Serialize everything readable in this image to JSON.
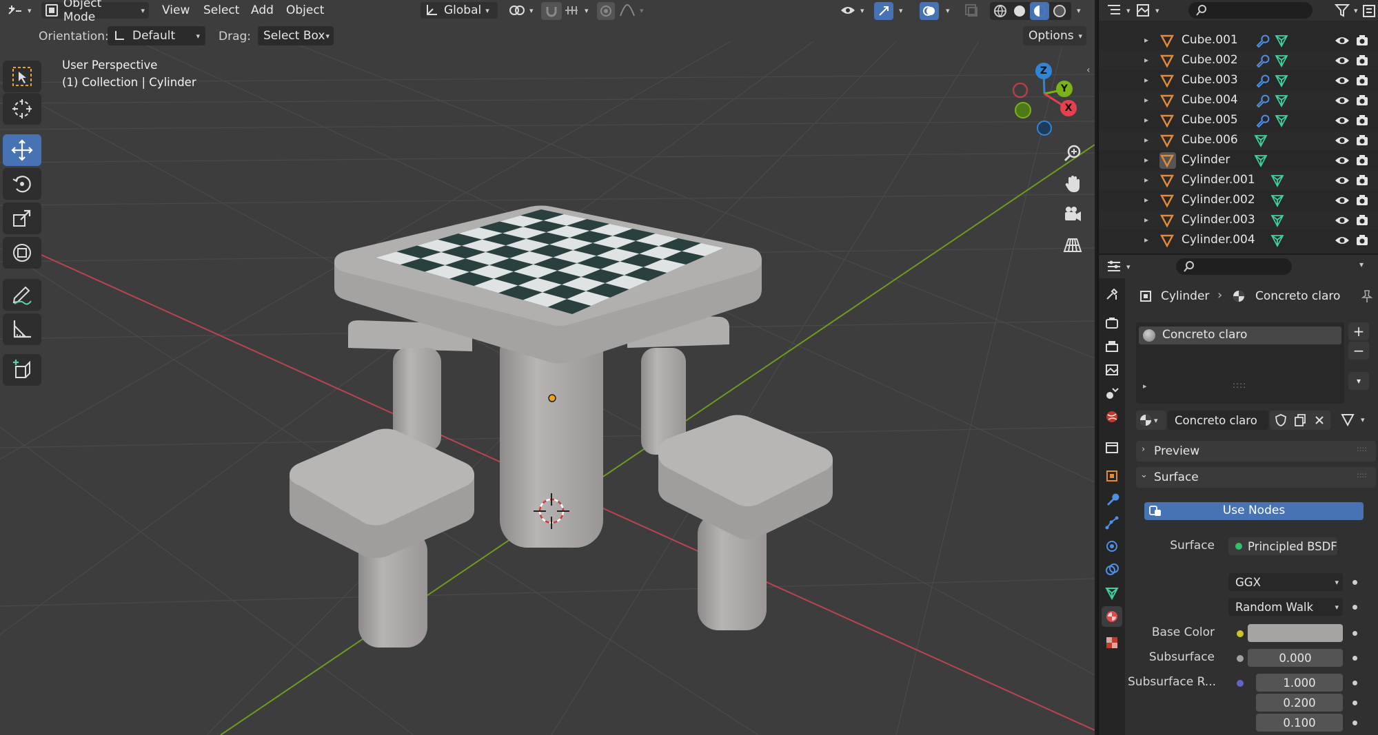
{
  "header": {
    "editor_type_icon": "editor-type-icon",
    "mode": "Object Mode",
    "menus": [
      "View",
      "Select",
      "Add",
      "Object"
    ],
    "transform_orientation": "Global"
  },
  "tool_settings": {
    "orientation_label": "Orientation:",
    "orientation_value": "Default",
    "drag_label": "Drag:",
    "drag_value": "Select Box",
    "options_label": "Options"
  },
  "viewport": {
    "info_line1": "User Perspective",
    "info_line2": "(1) Collection | Cylinder",
    "gizmo_axes": {
      "z": "Z",
      "y": "Y",
      "x": "X"
    }
  },
  "outliner": {
    "rows": [
      {
        "name": "Cube.001",
        "has_modifier": true
      },
      {
        "name": "Cube.002",
        "has_modifier": true
      },
      {
        "name": "Cube.003",
        "has_modifier": true
      },
      {
        "name": "Cube.004",
        "has_modifier": true
      },
      {
        "name": "Cube.005",
        "has_modifier": true
      },
      {
        "name": "Cube.006",
        "has_modifier": false
      },
      {
        "name": "Cylinder",
        "has_modifier": false,
        "active": true
      },
      {
        "name": "Cylinder.001",
        "has_modifier": false
      },
      {
        "name": "Cylinder.002",
        "has_modifier": false
      },
      {
        "name": "Cylinder.003",
        "has_modifier": false
      },
      {
        "name": "Cylinder.004",
        "has_modifier": false
      }
    ]
  },
  "properties": {
    "breadcrumb_object": "Cylinder",
    "breadcrumb_material": "Concreto claro",
    "slot_name": "Concreto claro",
    "material_name": "Concreto claro",
    "panel_preview": "Preview",
    "panel_surface": "Surface",
    "use_nodes_label": "Use Nodes",
    "surface_label": "Surface",
    "surface_value": "Principled BSDF",
    "distribution": "GGX",
    "subsurface_method": "Random Walk",
    "base_color_label": "Base Color",
    "base_color_hex": "#a6a3a3",
    "subsurface_label": "Subsurface",
    "subsurface_value": "0.000",
    "subsurface_radius_label": "Subsurface R...",
    "subsurface_radius": [
      "1.000",
      "0.200",
      "0.100"
    ]
  },
  "colors": {
    "accent": "#4772b3",
    "axis_x": "#e6404f",
    "axis_y": "#7ab319",
    "axis_z": "#2f86d9",
    "object_orange": "#e48b3a",
    "mesh_green": "#3fcf9a"
  }
}
